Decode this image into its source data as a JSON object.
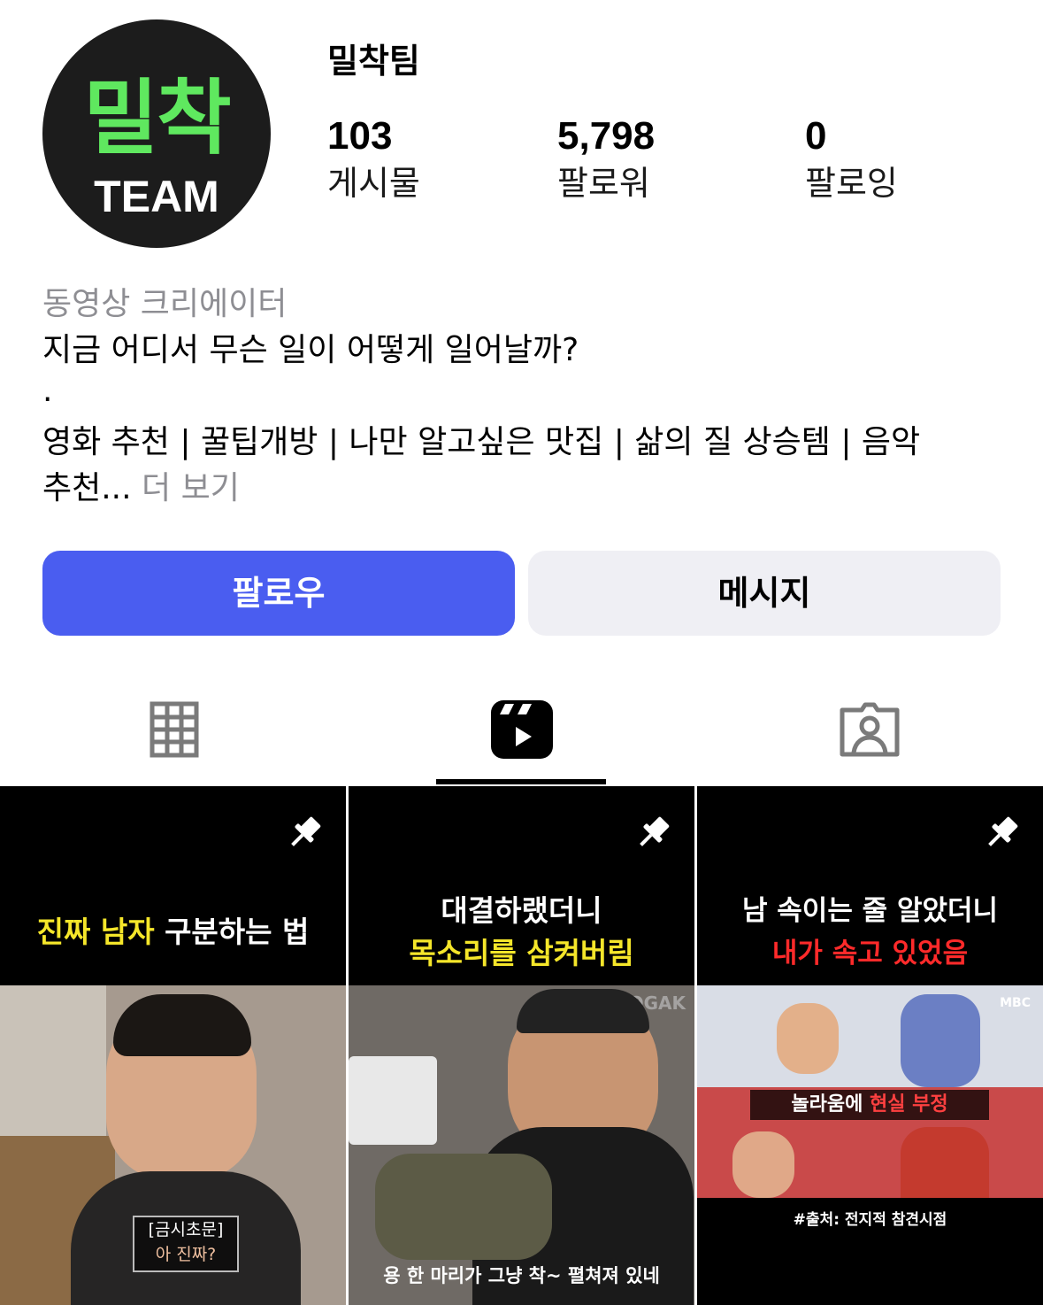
{
  "profile": {
    "avatar_top": "밀착",
    "avatar_bottom": "TEAM",
    "username": "밀착팀",
    "stats": [
      {
        "value": "103",
        "label": "게시물"
      },
      {
        "value": "5,798",
        "label": "팔로워"
      },
      {
        "value": "0",
        "label": "팔로잉"
      }
    ]
  },
  "bio": {
    "category": "동영상 크리에이터",
    "line1": "지금 어디서 무슨 일이 어떻게 일어날까?",
    "line2": ".",
    "line3": "영화 추천 | 꿀팁개방 | 나만 알고싶은 맛집 | 삶의 질 상승템 | 음악",
    "line4": "추천...",
    "more": "더 보기"
  },
  "buttons": {
    "follow": "팔로우",
    "message": "메시지"
  },
  "tabs": [
    {
      "icon": "grid-icon"
    },
    {
      "icon": "reels-icon",
      "active": true
    },
    {
      "icon": "tagged-icon"
    }
  ],
  "reels": [
    {
      "caption_plain": "진짜 남자 ",
      "caption_highlight": "구분하는 법",
      "sub1": "[금시초문]",
      "sub2": "아 진짜?"
    },
    {
      "caption_line1": "대결하랬더니",
      "caption_line2": "목소리를 삼켜버림",
      "watermark": "JOGAK",
      "subtitle": "용 한 마리가 그냥 착~ 펼쳐져 있네"
    },
    {
      "caption_line1": "남 속이는 줄 알았더니",
      "caption_line2": "내가 속고 있었음",
      "overlay_plain": "놀라움에 ",
      "overlay_highlight": "현실 부정",
      "source": "#출처: 전지적 참견시점",
      "broadcaster": "MBC"
    }
  ],
  "colors": {
    "follow_button": "#4a5df0",
    "message_button": "#efeff4",
    "logo_green": "#5fe85f",
    "caption_yellow": "#f5e62a",
    "caption_red": "#ff2a2a"
  }
}
